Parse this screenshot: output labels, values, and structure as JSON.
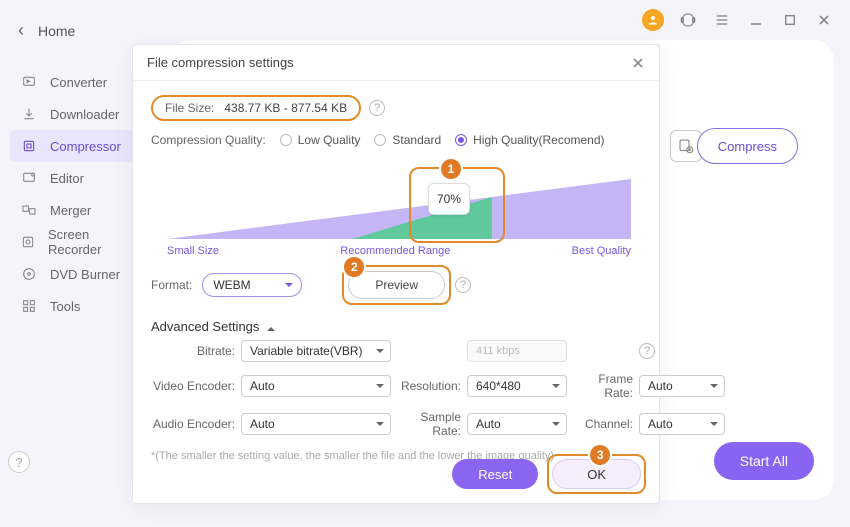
{
  "titlebar": {
    "avatar_initial": "",
    "icons": {
      "support": "support-icon",
      "menu": "menu-icon",
      "min": "minimize-icon",
      "max": "maximize-icon",
      "close": "close-icon"
    }
  },
  "homebar": {
    "back": "‹",
    "label": "Home"
  },
  "sidebar": {
    "items": [
      {
        "label": "Converter",
        "icon": "converter-icon"
      },
      {
        "label": "Downloader",
        "icon": "downloader-icon"
      },
      {
        "label": "Compressor",
        "icon": "compressor-icon",
        "active": true
      },
      {
        "label": "Editor",
        "icon": "editor-icon"
      },
      {
        "label": "Merger",
        "icon": "merger-icon"
      },
      {
        "label": "Screen Recorder",
        "icon": "screen-recorder-icon"
      },
      {
        "label": "DVD Burner",
        "icon": "dvd-burner-icon"
      },
      {
        "label": "Tools",
        "icon": "tools-icon"
      }
    ]
  },
  "right_panel": {
    "compress_label": "Compress",
    "start_all_label": "Start All"
  },
  "modal": {
    "title": "File compression settings",
    "file_size_label": "File Size:",
    "file_size_value": "438.77 KB - 877.54 KB",
    "quality": {
      "label": "Compression Quality:",
      "low": "Low Quality",
      "standard": "Standard",
      "high": "High Quality(Recomend)"
    },
    "slider": {
      "value_text": "70%",
      "left": "Small Size",
      "mid": "Recommended Range",
      "right": "Best Quality"
    },
    "format_label": "Format:",
    "format_value": "WEBM",
    "preview_label": "Preview",
    "advanced_label": "Advanced Settings",
    "bitrate_label": "Bitrate:",
    "bitrate_value": "Variable bitrate(VBR)",
    "bitrate_placeholder": "411 kbps",
    "video_encoder_label": "Video Encoder:",
    "video_encoder_value": "Auto",
    "resolution_label": "Resolution:",
    "resolution_value": "640*480",
    "frame_rate_label": "Frame Rate:",
    "frame_rate_value": "Auto",
    "audio_encoder_label": "Audio Encoder:",
    "audio_encoder_value": "Auto",
    "sample_rate_label": "Sample Rate:",
    "sample_rate_value": "Auto",
    "channel_label": "Channel:",
    "channel_value": "Auto",
    "note": "*(The smaller the setting value, the smaller the file and the lower the image quality)",
    "reset_label": "Reset",
    "ok_label": "OK"
  },
  "callouts": {
    "one": "1",
    "two": "2",
    "three": "3"
  }
}
